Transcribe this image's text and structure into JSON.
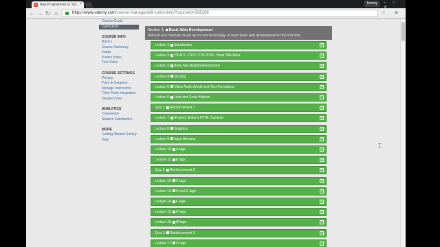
{
  "browser": {
    "tab_title": "Non-Programmer to Sof...",
    "user": "Tammy",
    "window_controls": "– □ ✕",
    "url_host": "https://www.udemy.com",
    "url_path": "/course-manage/edit-curriculum/?courseId=595266"
  },
  "sidebar": {
    "top_items": [
      {
        "label": "Course Goals"
      },
      {
        "label": "Curriculum",
        "active": true
      }
    ],
    "groups": [
      {
        "heading": "COURSE INFO",
        "items": [
          "Basics",
          "Course Summary",
          "Image",
          "Promo Video",
          "Test Video"
        ]
      },
      {
        "heading": "COURSE SETTINGS",
        "items": [
          "Privacy",
          "Price & Coupons",
          "Manage Instructors",
          "Third Party Integration",
          "Danger Zone"
        ]
      },
      {
        "heading": "ANALYTICS",
        "items": [
          "Conversion",
          "Student Satisfaction"
        ]
      },
      {
        "heading": "MORE",
        "items": [
          "Getting Started Survey",
          "Help"
        ]
      }
    ]
  },
  "section": {
    "label": "Section 1:",
    "title": "Basic Web Development",
    "description": "Refresh your memory, brush up on new technology, or learn basic web development for the first time."
  },
  "lectures": [
    {
      "label": "Lecture 1:",
      "title": "Introduction"
    },
    {
      "label": "Lecture 2:",
      "title": "HTML5 - DOCTYPE HTML Head Title Meta"
    },
    {
      "label": "Lecture 3:",
      "title": "Body Nav A(attributes/anchor)"
    },
    {
      "label": "Lecture 4:",
      "title": "Div Img"
    },
    {
      "label": "Lecture 5:",
      "title": "Video Audio Article and Text Formatters"
    },
    {
      "label": "Lecture 6:",
      "title": "Lists and Code Helpers"
    },
    {
      "label": "Quiz 1:",
      "title": "Reinforcement 1"
    },
    {
      "label": "Lecture 7:",
      "title": "iFrames Buttons HTML Symbols"
    },
    {
      "label": "Lecture 8:",
      "title": "Graphics"
    },
    {
      "label": "Lecture 9:",
      "title": "Input Streams"
    },
    {
      "label": "Lecture 10:",
      "title": "A tags"
    },
    {
      "label": "Lecture 11:",
      "title": "B tags"
    },
    {
      "label": "Quiz 2:",
      "title": "Reinforcement 2"
    },
    {
      "label": "Lecture 12:",
      "title": "C tags"
    },
    {
      "label": "Lecture 13:",
      "title": "D and E tags"
    },
    {
      "label": "Lecture 14:",
      "title": "F tags"
    },
    {
      "label": "Lecture 15:",
      "title": "H tags"
    },
    {
      "label": "Lecture 16:",
      "title": "M tags"
    },
    {
      "label": "Quiz 3:",
      "title": "Reinforcement 3"
    },
    {
      "label": "Lecture 17:",
      "title": "O tags"
    }
  ],
  "colors": {
    "lecture_green": "#55b04a",
    "section_gray": "#727272",
    "link_blue": "#3c6aa5"
  }
}
